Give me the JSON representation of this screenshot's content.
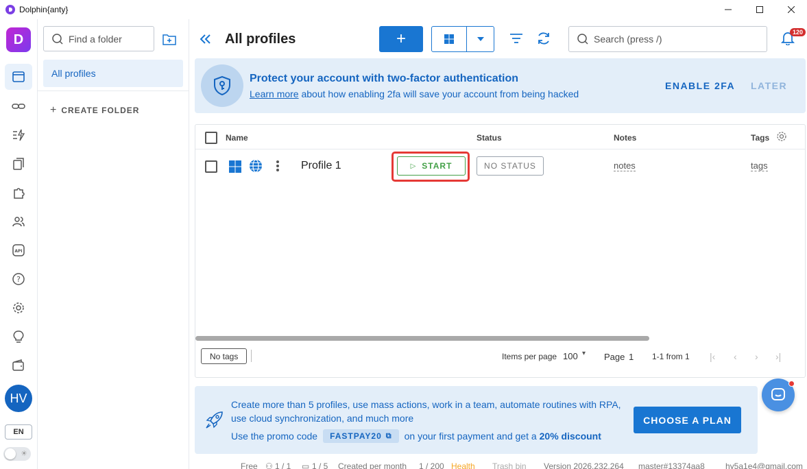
{
  "window": {
    "title": "Dolphin{anty}"
  },
  "rail": {
    "brand_letter": "D",
    "avatar_initials": "HV",
    "language": "EN"
  },
  "folders": {
    "search_placeholder": "Find a folder",
    "active_folder": "All profiles",
    "create_folder_label": "CREATE FOLDER"
  },
  "header": {
    "title": "All profiles",
    "add_label": "+",
    "search_placeholder": "Search (press /)",
    "notifications_count": "120"
  },
  "banner_2fa": {
    "headline": "Protect your account with two-factor authentication",
    "learn_more": "Learn more",
    "sub_rest": " about how enabling 2fa will save your account from being hacked",
    "enable_label": "ENABLE 2FA",
    "later_label": "LATER"
  },
  "table": {
    "columns": {
      "name": "Name",
      "status": "Status",
      "notes": "Notes",
      "tags": "Tags"
    },
    "rows": [
      {
        "name": "Profile 1",
        "start_label": "START",
        "status_label": "NO STATUS",
        "notes": "notes",
        "tags": "tags"
      }
    ],
    "footer": {
      "no_tags": "No tags",
      "items_per_page_label": "Items per page",
      "items_per_page_value": "100",
      "page_label": "Page",
      "page_value": "1",
      "range": "1-1 from 1"
    }
  },
  "promo": {
    "line1": "Create more than 5 profiles, use mass actions, work in a team, automate routines with RPA, use cloud synchronization, and much more",
    "code_prefix": "Use the promo code",
    "code": "FASTPAY20",
    "code_suffix": "on your first payment and get a",
    "discount": "20% discount",
    "plan_button": "CHOOSE A PLAN"
  },
  "statusbar": {
    "plan": "Free",
    "users": "1 / 1",
    "folders": "1 / 5",
    "created": "Created per month",
    "created_value": "1 / 200",
    "health": "Health",
    "trash": "Trash bin",
    "version": "Version 2026.232.264",
    "branch": "master#13374aa8",
    "email": "hy5a1e4@gmail.com"
  },
  "colors": {
    "accent": "#1976d2",
    "start": "#43a047",
    "highlight": "#e53935",
    "health": "#f5a623"
  }
}
